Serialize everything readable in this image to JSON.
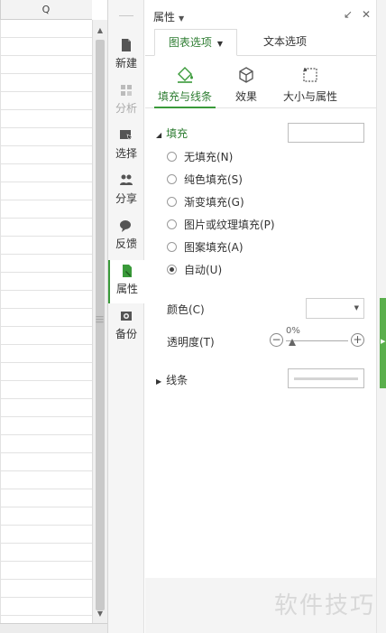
{
  "sheet": {
    "column_label": "Q"
  },
  "sidebar": {
    "items": [
      {
        "label": "新建",
        "icon": "new-file-icon",
        "enabled": true
      },
      {
        "label": "分析",
        "icon": "analysis-icon",
        "enabled": false
      },
      {
        "label": "选择",
        "icon": "select-icon",
        "enabled": true
      },
      {
        "label": "分享",
        "icon": "share-icon",
        "enabled": true
      },
      {
        "label": "反馈",
        "icon": "feedback-icon",
        "enabled": true
      },
      {
        "label": "属性",
        "icon": "properties-icon",
        "enabled": true,
        "active": true
      },
      {
        "label": "备份",
        "icon": "backup-icon",
        "enabled": true
      }
    ]
  },
  "panel": {
    "title": "属性",
    "tabs": [
      {
        "label": "图表选项",
        "active": true
      },
      {
        "label": "文本选项",
        "active": false
      }
    ],
    "subtabs": [
      {
        "label": "填充与线条",
        "icon": "fill-bucket-icon",
        "active": true
      },
      {
        "label": "效果",
        "icon": "cube-icon",
        "active": false
      },
      {
        "label": "大小与属性",
        "icon": "size-icon",
        "active": false
      }
    ],
    "fill_section": {
      "title": "填充",
      "options": [
        {
          "label": "无填充(N)",
          "checked": false
        },
        {
          "label": "纯色填充(S)",
          "checked": false
        },
        {
          "label": "渐变填充(G)",
          "checked": false
        },
        {
          "label": "图片或纹理填充(P)",
          "checked": false
        },
        {
          "label": "图案填充(A)",
          "checked": false
        },
        {
          "label": "自动(U)",
          "checked": true
        }
      ],
      "color_label": "颜色(C)",
      "transparency_label": "透明度(T)",
      "transparency_value": "0%"
    },
    "line_section": {
      "title": "线条"
    }
  },
  "watermark": "软件技巧",
  "colors": {
    "accent_green": "#3a9a3a",
    "scroll_green": "#5aaf4c"
  }
}
